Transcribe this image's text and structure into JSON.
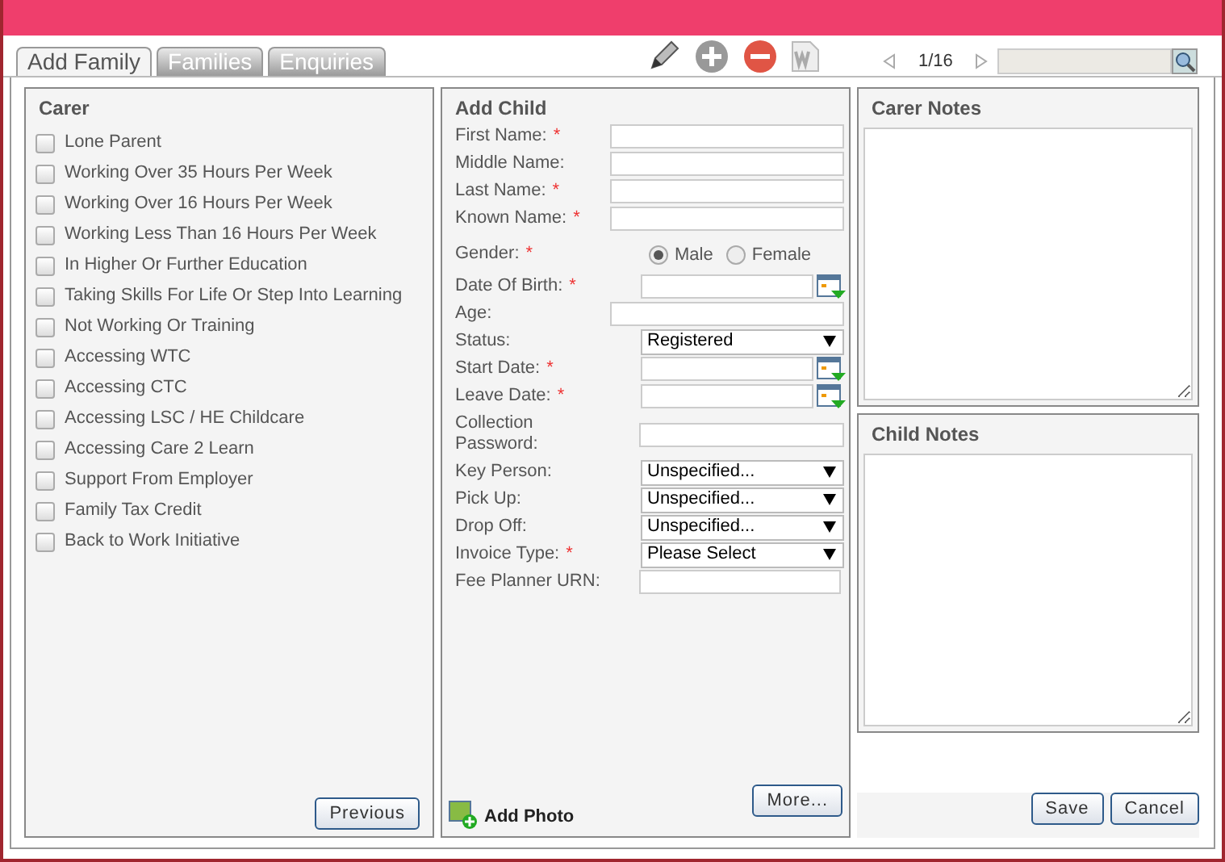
{
  "tabs": [
    {
      "label": "Add Family",
      "selected": true
    },
    {
      "label": "Families",
      "selected": false
    },
    {
      "label": "Enquiries",
      "selected": false
    }
  ],
  "pager": {
    "position": "1/16"
  },
  "carer": {
    "title": "Carer",
    "items": [
      {
        "label": "Lone Parent",
        "checked": false
      },
      {
        "label": "Working Over 35 Hours Per Week",
        "checked": false
      },
      {
        "label": "Working Over 16 Hours Per Week",
        "checked": false
      },
      {
        "label": "Working Less Than 16 Hours Per Week",
        "checked": false
      },
      {
        "label": "In Higher Or Further Education",
        "checked": false
      },
      {
        "label": "Taking Skills For Life Or Step Into Learning",
        "checked": false
      },
      {
        "label": "Not Working Or Training",
        "checked": false
      },
      {
        "label": "Accessing WTC",
        "checked": false
      },
      {
        "label": "Accessing CTC",
        "checked": false
      },
      {
        "label": "Accessing LSC / HE Childcare",
        "checked": false
      },
      {
        "label": "Accessing Care 2 Learn",
        "checked": false
      },
      {
        "label": "Support From Employer",
        "checked": false
      },
      {
        "label": "Family Tax Credit",
        "checked": false
      },
      {
        "label": "Back to Work Initiative",
        "checked": false
      }
    ],
    "button": "Previous"
  },
  "add_child": {
    "title": "Add Child",
    "fields": [
      {
        "label": "First Name:",
        "required_mark": "*",
        "kind": "text"
      },
      {
        "label": "Middle Name:",
        "kind": "text"
      },
      {
        "label": "Last Name:",
        "required_mark": "*",
        "kind": "text"
      },
      {
        "label": "Known Name:",
        "required_mark": "*",
        "kind": "text"
      },
      {
        "label": "Gender:",
        "required_mark": "*",
        "kind": "radio",
        "options": [
          {
            "label": "Male",
            "selected": true
          },
          {
            "label": "Female",
            "selected": false
          }
        ]
      },
      {
        "label": "Date Of Birth:",
        "required_mark": "*",
        "kind": "date"
      },
      {
        "label": "Age:",
        "kind": "text"
      },
      {
        "label": "Status:",
        "kind": "select",
        "value": "Registered"
      },
      {
        "label": "Start Date:",
        "required_mark": "*",
        "kind": "date"
      },
      {
        "label": "Leave Date:",
        "required_mark": "*",
        "kind": "date"
      },
      {
        "label": "Collection Password:",
        "kind": "password"
      },
      {
        "label": "Key Person:",
        "kind": "select",
        "value": "Unspecified..."
      },
      {
        "label": "Pick Up:",
        "kind": "select",
        "value": "Unspecified..."
      },
      {
        "label": "Drop Off:",
        "kind": "select",
        "value": "Unspecified..."
      },
      {
        "label": "Invoice Type:",
        "required_mark": "*",
        "kind": "select",
        "value": "Please Select"
      },
      {
        "label": "Fee Planner URN:",
        "kind": "urn"
      }
    ],
    "add_photo": "Add Photo",
    "more_button": "More..."
  },
  "carer_notes": {
    "title": "Carer Notes"
  },
  "child_notes": {
    "title": "Child Notes"
  },
  "buttons": [
    "Save",
    "Cancel"
  ]
}
